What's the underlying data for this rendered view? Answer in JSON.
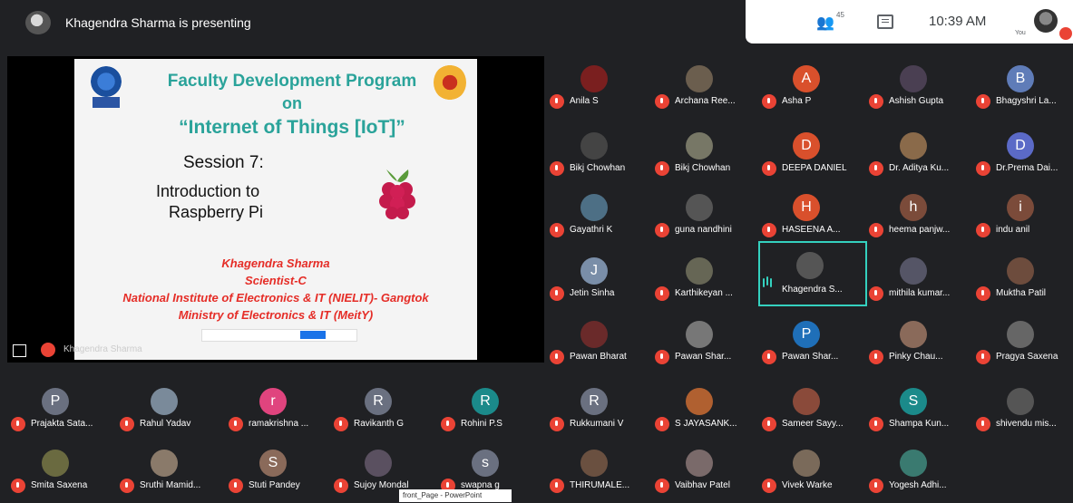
{
  "topbar": {
    "presenting_text": "Khagendra Sharma is presenting",
    "people_count": "45",
    "clock": "10:39 AM",
    "you_label": "You"
  },
  "slide": {
    "title_line1": "Faculty Development Program",
    "title_line2": "on",
    "title_line3": "“Internet of Things [IoT]”",
    "session": "Session 7:",
    "intro_line1": "Introduction to",
    "intro_line2": "Raspberry Pi",
    "author_line1": "Khagendra Sharma",
    "author_line2": "Scientist-C",
    "author_line3": "National Institute of Electronics & IT (NIELIT)- Gangtok",
    "author_line4": "Ministry of Electronics & IT (MeitY)",
    "footer_name": "Khagendra Sharma"
  },
  "taskbar_tag": "front_Page - PowerPoint",
  "colors": {
    "mic_red": "#ea4335",
    "speaking_teal": "#34d1bf",
    "slide_teal": "#2aa39a",
    "slide_red": "#e52d27"
  },
  "participants": [
    {
      "name": "Anila S",
      "initial": "",
      "color": "#7a1f1f"
    },
    {
      "name": "Archana Ree...",
      "initial": "",
      "color": "#6b5e4e"
    },
    {
      "name": "Asha P",
      "initial": "A",
      "color": "#d9502c"
    },
    {
      "name": "Ashish Gupta",
      "initial": "",
      "color": "#4a3f52"
    },
    {
      "name": "Bhagyshri La...",
      "initial": "B",
      "color": "#5f7cb8"
    },
    {
      "name": "Bikj Chowhan",
      "initial": "",
      "color": "#444"
    },
    {
      "name": "Bikj Chowhan",
      "initial": "",
      "color": "#776"
    },
    {
      "name": "DEEPA DANIEL",
      "initial": "D",
      "color": "#d9502c"
    },
    {
      "name": "Dr. Aditya Ku...",
      "initial": "",
      "color": "#8a6a4a"
    },
    {
      "name": "Dr.Prema Dai...",
      "initial": "D",
      "color": "#5b6ac7"
    },
    {
      "name": "Gayathri K",
      "initial": "",
      "color": "#4d6f85"
    },
    {
      "name": "guna nandhini",
      "initial": "",
      "color": "#555"
    },
    {
      "name": "HASEENA A...",
      "initial": "H",
      "color": "#d9502c"
    },
    {
      "name": "heema panjw...",
      "initial": "h",
      "color": "#7b4b3a"
    },
    {
      "name": "indu anil",
      "initial": "i",
      "color": "#7b4b3a"
    },
    {
      "name": "Jetin Sinha",
      "initial": "J",
      "color": "#7a8ea8"
    },
    {
      "name": "Karthikeyan ...",
      "initial": "",
      "color": "#665"
    },
    {
      "name": "Khagendra S...",
      "initial": "",
      "color": "#555"
    },
    {
      "name": "mithila kumar...",
      "initial": "",
      "color": "#556"
    },
    {
      "name": "Muktha Patil",
      "initial": "",
      "color": "#6d4c3d"
    },
    {
      "name": "Pawan Bharat",
      "initial": "",
      "color": "#6a2a2a"
    },
    {
      "name": "Pawan Shar...",
      "initial": "",
      "color": "#777"
    },
    {
      "name": "Pawan Shar...",
      "initial": "P",
      "color": "#1f6fb8"
    },
    {
      "name": "Pinky Chau...",
      "initial": "",
      "color": "#8a6a5a"
    },
    {
      "name": "Pragya Saxena",
      "initial": "",
      "color": "#666"
    },
    {
      "name": "Prajakta Sata...",
      "initial": "P",
      "color": "#6a7080"
    },
    {
      "name": "Rahul Yadav",
      "initial": "",
      "color": "#7a8a9a"
    },
    {
      "name": "ramakrishna ...",
      "initial": "r",
      "color": "#e0447e"
    },
    {
      "name": "Ravikanth G",
      "initial": "R",
      "color": "#6a7080"
    },
    {
      "name": "Rohini P.S",
      "initial": "R",
      "color": "#1b8a8a"
    },
    {
      "name": "Rukkumani V",
      "initial": "R",
      "color": "#6a7080"
    },
    {
      "name": "S JAYASANK...",
      "initial": "",
      "color": "#b06030"
    },
    {
      "name": "Sameer Sayy...",
      "initial": "",
      "color": "#8a4a3a"
    },
    {
      "name": "Shampa Kun...",
      "initial": "S",
      "color": "#1b8a8a"
    },
    {
      "name": "shivendu mis...",
      "initial": "",
      "color": "#555"
    },
    {
      "name": "Smita Saxena",
      "initial": "",
      "color": "#6a6a40"
    },
    {
      "name": "Sruthi Mamid...",
      "initial": "",
      "color": "#8a7a6a"
    },
    {
      "name": "Stuti Pandey",
      "initial": "S",
      "color": "#8a6a5a"
    },
    {
      "name": "Sujoy Mondal",
      "initial": "",
      "color": "#5a5060"
    },
    {
      "name": "swapna g",
      "initial": "s",
      "color": "#6a7080"
    },
    {
      "name": "THIRUMALE...",
      "initial": "",
      "color": "#6a5040"
    },
    {
      "name": "Vaibhav Patel",
      "initial": "",
      "color": "#7a6a6a"
    },
    {
      "name": "Vivek Warke",
      "initial": "",
      "color": "#7a6a5a"
    },
    {
      "name": "Yogesh Adhi...",
      "initial": "",
      "color": "#3a7a70"
    }
  ]
}
